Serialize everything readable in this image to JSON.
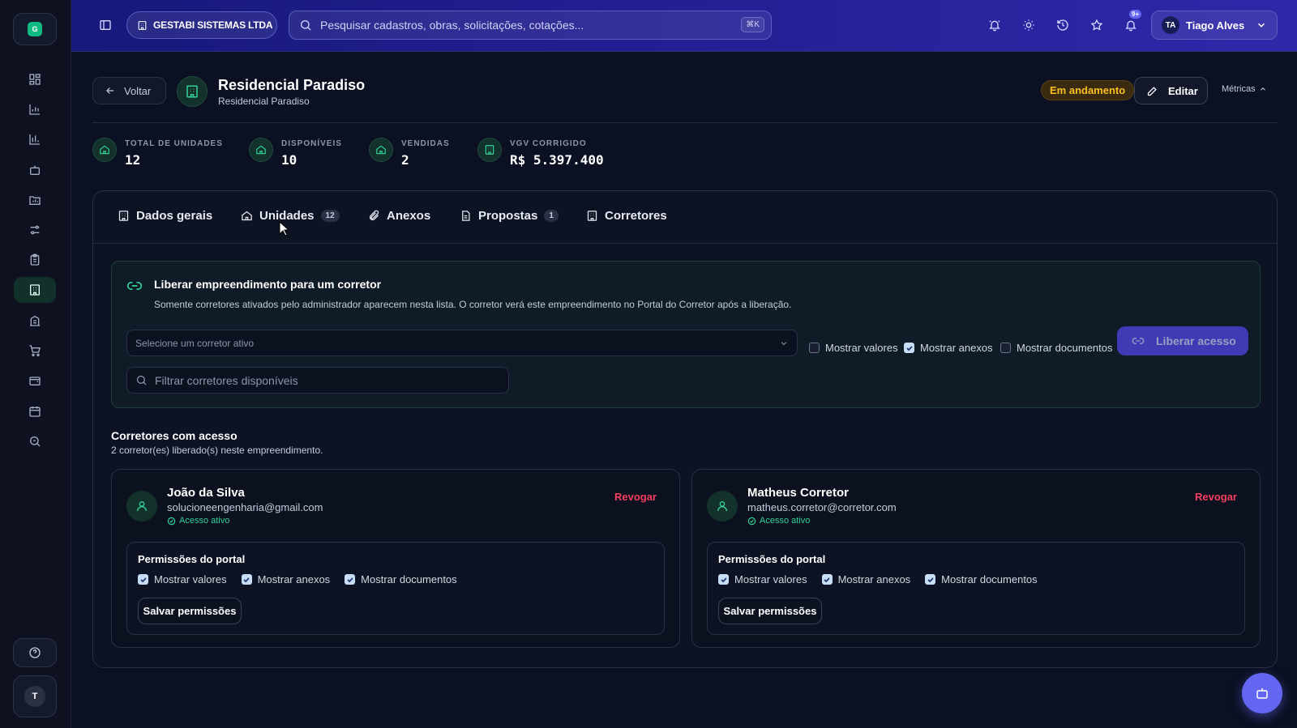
{
  "sidebar": {
    "logo": "G",
    "items": [
      {
        "icon": "dashboard-icon"
      },
      {
        "icon": "bar-chart-icon"
      },
      {
        "icon": "bar-chart-2-icon"
      },
      {
        "icon": "bot-icon"
      },
      {
        "icon": "folder-chart-icon"
      },
      {
        "icon": "sliders-icon"
      },
      {
        "icon": "clipboard-icon"
      },
      {
        "icon": "building-icon",
        "active": true
      },
      {
        "icon": "building-2-icon"
      },
      {
        "icon": "cart-icon"
      },
      {
        "icon": "wallet-icon"
      },
      {
        "icon": "calendar-icon"
      },
      {
        "icon": "search-zoom-icon"
      }
    ],
    "help_icon": "help-circle-icon",
    "user_initial": "T"
  },
  "topbar": {
    "company": "GESTABI SISTEMAS LTDA",
    "search_placeholder": "Pesquisar cadastros, obras, solicitações, cotações...",
    "shortcut": "⌘K",
    "notification_badge": "9+",
    "user_initials": "TA",
    "user_name": "Tiago Alves"
  },
  "header": {
    "back_label": "Voltar",
    "title": "Residencial Paradiso",
    "subtitle": "Residencial Paradiso",
    "status": "Em andamento",
    "edit_label": "Editar",
    "metrics_label": "Métricas"
  },
  "stats": [
    {
      "label": "TOTAL DE UNIDADES",
      "value": "12"
    },
    {
      "label": "DISPONÍVEIS",
      "value": "10"
    },
    {
      "label": "VENDIDAS",
      "value": "2"
    },
    {
      "label": "VGV CORRIGIDO",
      "value": "R$ 5.397.400"
    }
  ],
  "tabs": [
    {
      "label": "Dados gerais"
    },
    {
      "label": "Unidades",
      "count": "12"
    },
    {
      "label": "Anexos"
    },
    {
      "label": "Propostas",
      "count": "1"
    },
    {
      "label": "Corretores",
      "active": true
    }
  ],
  "liberar": {
    "title": "Liberar empreendimento para um corretor",
    "description": "Somente corretores ativados pelo administrador aparecem nesta lista. O corretor verá este empreendimento no Portal do Corretor após a liberação.",
    "select_placeholder": "Selecione um corretor ativo",
    "options": [
      {
        "label": "Mostrar valores",
        "checked": false
      },
      {
        "label": "Mostrar anexos",
        "checked": true
      },
      {
        "label": "Mostrar documentos",
        "checked": false
      }
    ],
    "button_label": "Liberar acesso",
    "filter_placeholder": "Filtrar corretores disponíveis"
  },
  "access": {
    "title": "Corretores com acesso",
    "subtitle": "2 corretor(es) liberado(s) neste empreendimento.",
    "brokers": [
      {
        "name": "João da Silva",
        "email": "solucioneengenharia@gmail.com",
        "status": "Acesso ativo",
        "revoke_label": "Revogar",
        "perm_title": "Permissões do portal",
        "perms": [
          {
            "label": "Mostrar valores",
            "checked": true
          },
          {
            "label": "Mostrar anexos",
            "checked": true
          },
          {
            "label": "Mostrar documentos",
            "checked": true
          }
        ],
        "save_label": "Salvar permissões"
      },
      {
        "name": "Matheus Corretor",
        "email": "matheus.corretor@corretor.com",
        "status": "Acesso ativo",
        "revoke_label": "Revogar",
        "perm_title": "Permissões do portal",
        "perms": [
          {
            "label": "Mostrar valores",
            "checked": true
          },
          {
            "label": "Mostrar anexos",
            "checked": true
          },
          {
            "label": "Mostrar documentos",
            "checked": true
          }
        ],
        "save_label": "Salvar permissões"
      }
    ]
  },
  "colors": {
    "accent": "#6366f1",
    "success": "#34d399",
    "danger": "#f43f5e",
    "warning": "#fbbf24"
  }
}
